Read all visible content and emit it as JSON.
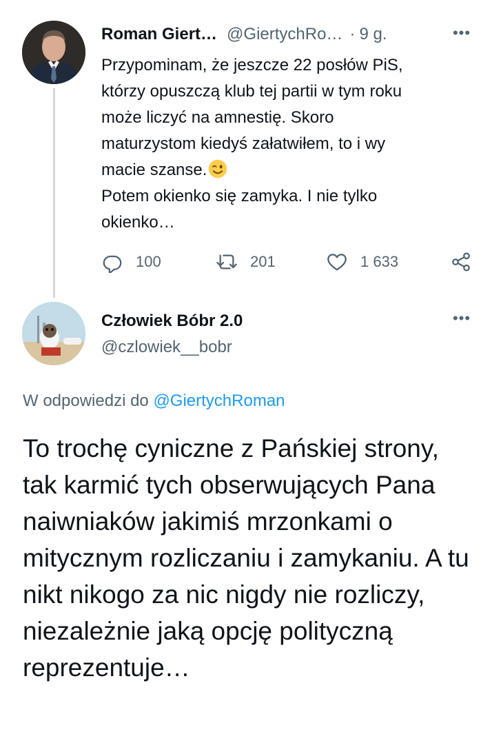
{
  "tweet1": {
    "name": "Roman Giert…",
    "handle": "@GiertychRo…",
    "separator": "·",
    "time": "9 g.",
    "text_lines": [
      "Przypominam, że jeszcze 22 posłów PiS,",
      "którzy opuszczą klub tej partii w tym roku",
      "może liczyć na amnestię. Skoro",
      "maturzystom kiedyś załatwiłem, to i wy",
      "macie szanse.",
      "Potem okienko się zamyka. I nie tylko",
      "okienko…"
    ],
    "emoji": "winking-face-emoji",
    "replies": "100",
    "retweets": "201",
    "likes": "1 633",
    "more": "•••"
  },
  "tweet2": {
    "name": "Człowiek Bóbr 2.0",
    "handle": "@czlowiek__bobr",
    "reply_prefix": "W odpowiedzi do",
    "reply_to": "@GiertychRoman",
    "text": "To trochę cyniczne z Pańskiej strony, tak karmić tych obserwujących Pana naiwniaków jakimiś mrzonkami o mitycznym rozliczaniu i zamykaniu. A tu nikt nikogo za nic nigdy nie rozliczy, niezależnie jaką opcję polityczną reprezentuje…",
    "more": "•••"
  },
  "colors": {
    "text": "#0f1419",
    "secondary": "#536471",
    "link": "#1d9bf0",
    "thread_line": "#cfd9de"
  },
  "icons": [
    "reply-icon",
    "retweet-icon",
    "like-icon",
    "share-icon",
    "more-icon"
  ]
}
